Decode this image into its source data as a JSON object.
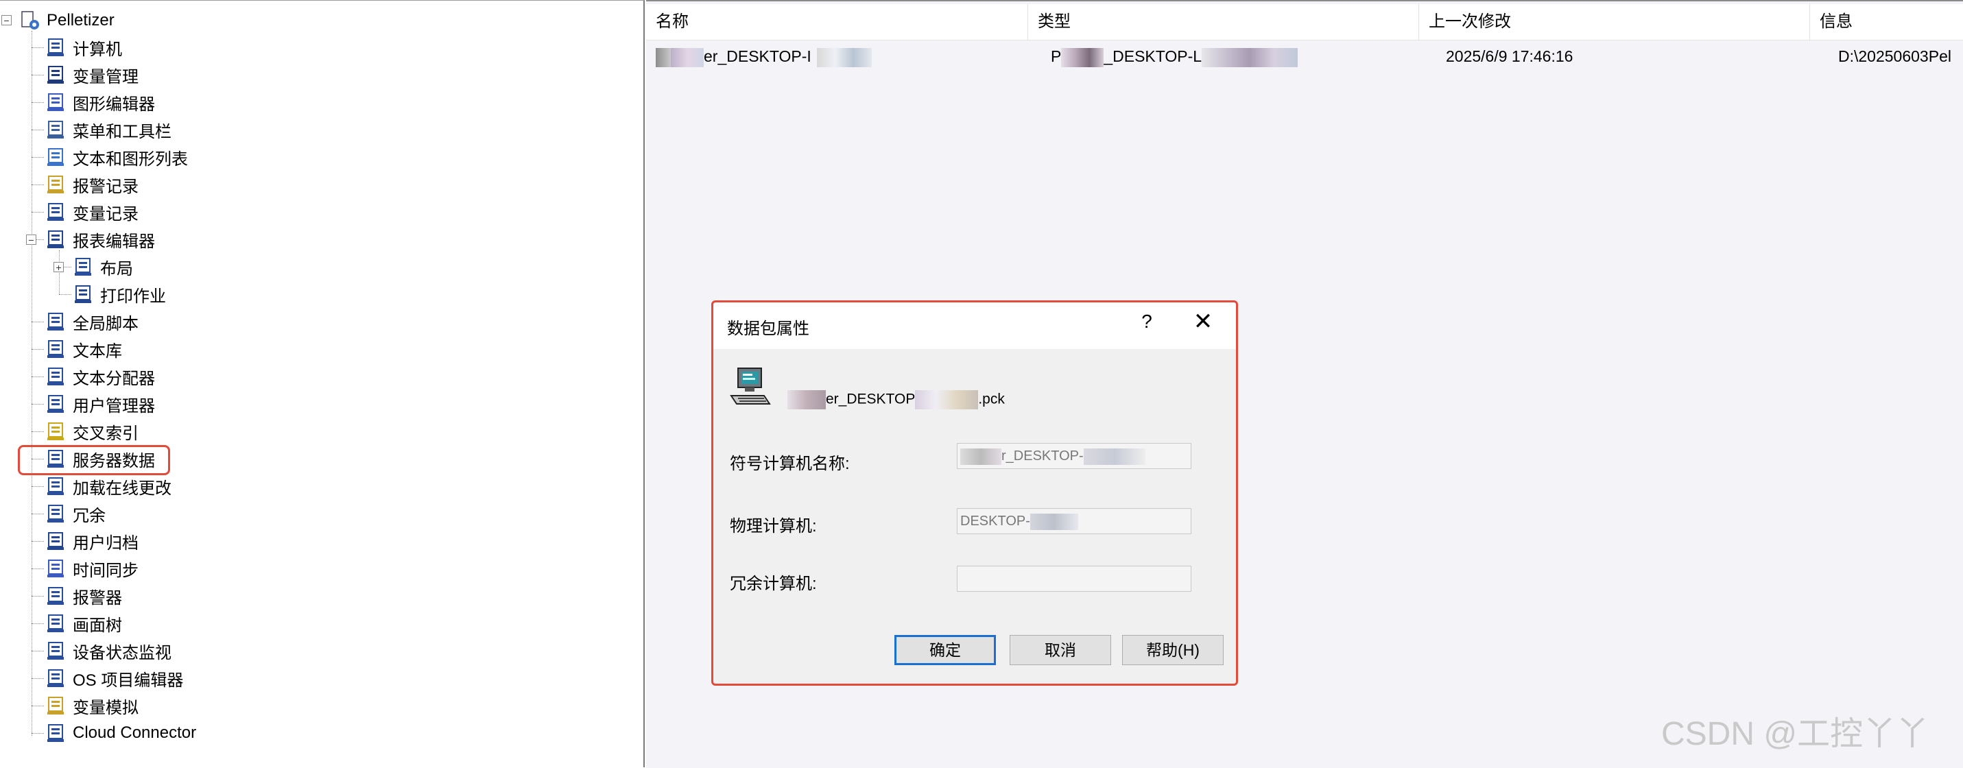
{
  "tree": {
    "root_label": "Pelletizer",
    "items": [
      {
        "label": "计算机",
        "icon": "computer-icon"
      },
      {
        "label": "变量管理",
        "icon": "tag-management-icon"
      },
      {
        "label": "图形编辑器",
        "icon": "graphics-editor-icon"
      },
      {
        "label": "菜单和工具栏",
        "icon": "menu-toolbar-icon"
      },
      {
        "label": "文本和图形列表",
        "icon": "text-graphic-list-icon"
      },
      {
        "label": "报警记录",
        "icon": "alarm-logging-icon"
      },
      {
        "label": "变量记录",
        "icon": "tag-logging-icon"
      },
      {
        "label": "报表编辑器",
        "icon": "report-designer-icon"
      },
      {
        "label": "布局",
        "icon": "layout-icon"
      },
      {
        "label": "打印作业",
        "icon": "print-job-icon"
      },
      {
        "label": "全局脚本",
        "icon": "global-script-icon"
      },
      {
        "label": "文本库",
        "icon": "text-library-icon"
      },
      {
        "label": "文本分配器",
        "icon": "text-distributor-icon"
      },
      {
        "label": "用户管理器",
        "icon": "user-administrator-icon"
      },
      {
        "label": "交叉索引",
        "icon": "cross-reference-icon"
      },
      {
        "label": "服务器数据",
        "icon": "server-data-icon"
      },
      {
        "label": "加载在线更改",
        "icon": "load-online-changes-icon"
      },
      {
        "label": "冗余",
        "icon": "redundancy-icon"
      },
      {
        "label": "用户归档",
        "icon": "user-archive-icon"
      },
      {
        "label": "时间同步",
        "icon": "time-sync-icon"
      },
      {
        "label": "报警器",
        "icon": "horn-icon"
      },
      {
        "label": "画面树",
        "icon": "picture-tree-icon"
      },
      {
        "label": "设备状态监视",
        "icon": "device-monitor-icon"
      },
      {
        "label": "OS 项目编辑器",
        "icon": "os-project-editor-icon"
      },
      {
        "label": "变量模拟",
        "icon": "tag-simulator-icon"
      },
      {
        "label": "Cloud Connector",
        "icon": "cloud-connector-icon"
      }
    ]
  },
  "list": {
    "columns": [
      "名称",
      "类型",
      "上一次修改",
      "信息"
    ],
    "row": {
      "name_prefix": "",
      "name_visible": "er_DESKTOP-I",
      "type_visible": "P",
      "type_visible2": "_DESKTOP-L",
      "modified": "2025/6/9 17:46:16",
      "info": "D:\\20250603Pel"
    }
  },
  "dialog": {
    "title": "数据包属性",
    "help_glyph": "?",
    "close_glyph": "✕",
    "package_name_visible": "er_DESKTOP",
    "package_ext": ".pck",
    "symbolic_label": "符号计算机名称:",
    "symbolic_value": "r_DESKTOP-",
    "physical_label": "物理计算机:",
    "physical_value": "DESKTOP-",
    "redundant_label": "冗余计算机:",
    "redundant_value": "",
    "ok": "确定",
    "cancel": "取消",
    "help": "帮助(H)"
  },
  "watermark": "CSDN @工控丫丫",
  "colors": {
    "highlight_border": "#e24a3a",
    "default_button_border": "#1a6fd0",
    "list_background": "#f3f3f8"
  }
}
